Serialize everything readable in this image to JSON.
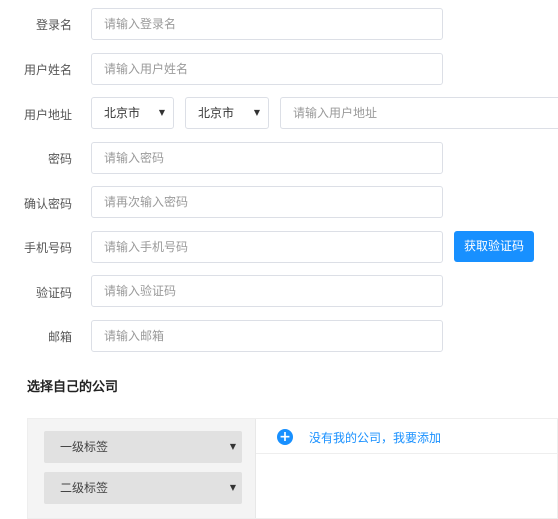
{
  "form": {
    "login": {
      "label": "登录名",
      "placeholder": "请输入登录名"
    },
    "username": {
      "label": "用户姓名",
      "placeholder": "请输入用户姓名"
    },
    "address": {
      "label": "用户地址",
      "city1": "北京市",
      "city2": "北京市",
      "placeholder": "请输入用户地址"
    },
    "password": {
      "label": "密码",
      "placeholder": "请输入密码"
    },
    "confirm_password": {
      "label": "确认密码",
      "placeholder": "请再次输入密码"
    },
    "phone": {
      "label": "手机号码",
      "placeholder": "请输入手机号码",
      "code_button": "获取验证码"
    },
    "code": {
      "label": "验证码",
      "placeholder": "请输入验证码"
    },
    "email": {
      "label": "邮箱",
      "placeholder": "请输入邮箱"
    }
  },
  "company": {
    "title": "选择自己的公司",
    "tag1": "一级标签",
    "tag2": "二级标签",
    "add_link": "没有我的公司，我要添加",
    "add_icon": "plus-circle-icon"
  },
  "colors": {
    "accent": "#1890ff"
  }
}
